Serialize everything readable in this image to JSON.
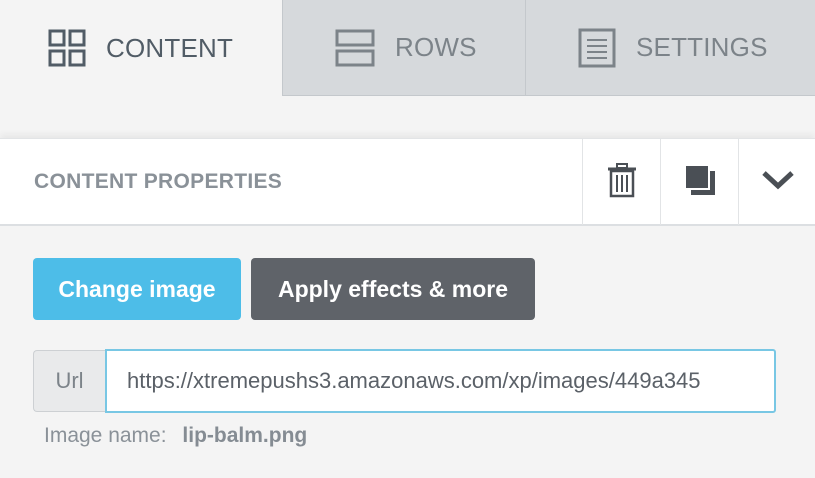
{
  "tabs": [
    {
      "label": "CONTENT",
      "icon": "grid-icon",
      "active": true
    },
    {
      "label": "ROWS",
      "icon": "rows-icon",
      "active": false
    },
    {
      "label": "SETTINGS",
      "icon": "settings-list-icon",
      "active": false
    }
  ],
  "properties": {
    "title": "CONTENT PROPERTIES",
    "actions": [
      "trash-icon",
      "duplicate-icon",
      "chevron-down-icon"
    ]
  },
  "buttons": {
    "change_image": "Change image",
    "apply_effects": "Apply effects & more"
  },
  "url": {
    "addon_label": "Url",
    "value": "https://xtremepushs3.amazonaws.com/xp/images/449a345"
  },
  "image": {
    "name_label": "Image name:",
    "name_value": "lip-balm.png"
  },
  "colors": {
    "accent": "#4dbde8",
    "dark_button": "#5f6369",
    "active_tab_text": "#515c66",
    "inactive_tab_bg": "#d6d9dc"
  }
}
